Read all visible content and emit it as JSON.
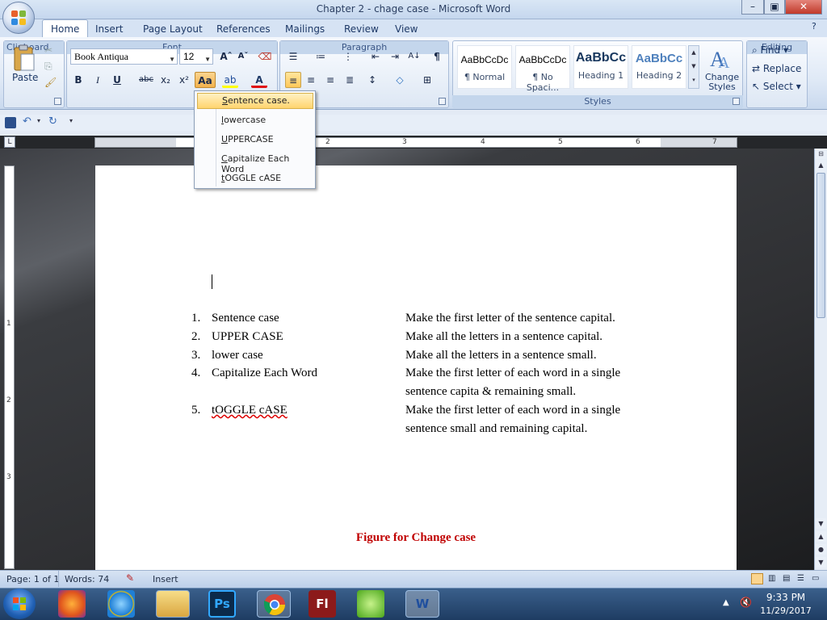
{
  "window": {
    "title": "Chapter 2 - chage case - Microsoft Word",
    "minimize": "–",
    "maximize": "▣",
    "close": "✕"
  },
  "tabs": [
    "Home",
    "Insert",
    "Page Layout",
    "References",
    "Mailings",
    "Review",
    "View"
  ],
  "active_tab": "Home",
  "clipboard": {
    "paste_label": "Paste",
    "group_label": "Clipboard"
  },
  "font": {
    "family": "Book Antiqua",
    "size": "12",
    "group_label": "Font",
    "bold": "B",
    "italic": "I",
    "underline": "U",
    "strike": "abc",
    "subscript": "x₂",
    "superscript": "x²",
    "change_case": "Aa",
    "grow": "Aˆ",
    "shrink": "Aˇ",
    "font_color_letter": "A"
  },
  "paragraph": {
    "group_label": "Paragraph",
    "pilcrow": "¶"
  },
  "styles": {
    "group_label": "Styles",
    "items": [
      {
        "sample": "AaBbCcDc",
        "name": "¶ Normal"
      },
      {
        "sample": "AaBbCcDc",
        "name": "¶ No Spaci..."
      },
      {
        "sample": "AaBbCc",
        "name": "Heading 1"
      },
      {
        "sample": "AaBbCc",
        "name": "Heading 2"
      }
    ],
    "change_styles": "Change Styles"
  },
  "editing": {
    "group_label": "Editing",
    "find": "Find",
    "replace": "Replace",
    "select": "Select"
  },
  "ruler": {
    "h_numbers": [
      "1",
      "2",
      "3",
      "4",
      "5",
      "6",
      "7"
    ],
    "v_numbers": [
      "1",
      "2",
      "3"
    ]
  },
  "case_menu": {
    "items": [
      {
        "accel": "S",
        "rest": "entence case."
      },
      {
        "accel": "l",
        "rest": "owercase"
      },
      {
        "accel": "U",
        "rest": "PPERCASE"
      },
      {
        "accel": "C",
        "rest": "apitalize Each Word"
      },
      {
        "accel": "t",
        "rest": "OGGLE cASE"
      }
    ]
  },
  "document": {
    "list": [
      {
        "num": "1.",
        "term": "Sentence case",
        "desc": [
          "Make the first letter of the sentence capital."
        ]
      },
      {
        "num": "2.",
        "term": "UPPER CASE",
        "desc": [
          "Make all the letters in a sentence capital."
        ]
      },
      {
        "num": "3.",
        "term": "lower case",
        "desc": [
          "Make all the letters in a sentence small."
        ]
      },
      {
        "num": "4.",
        "term": "Capitalize Each Word",
        "desc": [
          "Make the first letter of each word in a single",
          "sentence capita & remaining small."
        ]
      },
      {
        "num": "5.",
        "term": "tOGGLE cASE",
        "desc": [
          "Make the first letter of each word in a single",
          "sentence small and remaining capital."
        ]
      }
    ],
    "caption": "Figure for Change case"
  },
  "status": {
    "page": "Page: 1 of 1",
    "words": "Words: 74",
    "mode": "Insert"
  },
  "taskbar": {
    "time": "9:33 PM",
    "date": "11/29/2017"
  },
  "colors": {
    "caption": "#c00000",
    "highlight": "#ffd46e",
    "taskbar": "#1e3c62"
  }
}
